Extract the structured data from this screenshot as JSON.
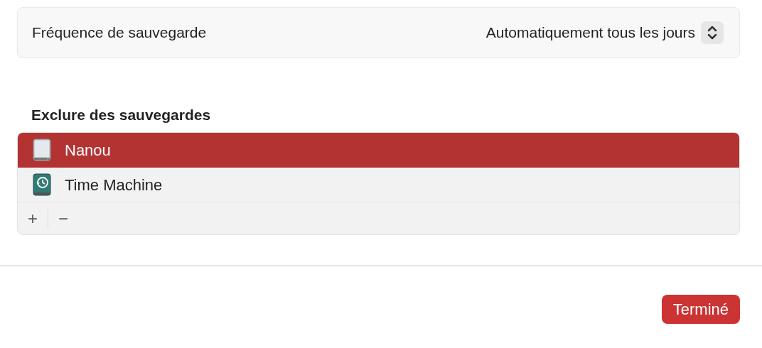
{
  "frequency": {
    "label": "Fréquence de sauvegarde",
    "value": "Automatiquement tous les jours"
  },
  "exclude": {
    "title": "Exclure des sauvegardes",
    "items": [
      {
        "name": "Nanou",
        "kind": "drive",
        "selected": true
      },
      {
        "name": "Time Machine",
        "kind": "timemachine",
        "selected": false
      }
    ],
    "add": "+",
    "remove": "−"
  },
  "done_button": "Terminé"
}
